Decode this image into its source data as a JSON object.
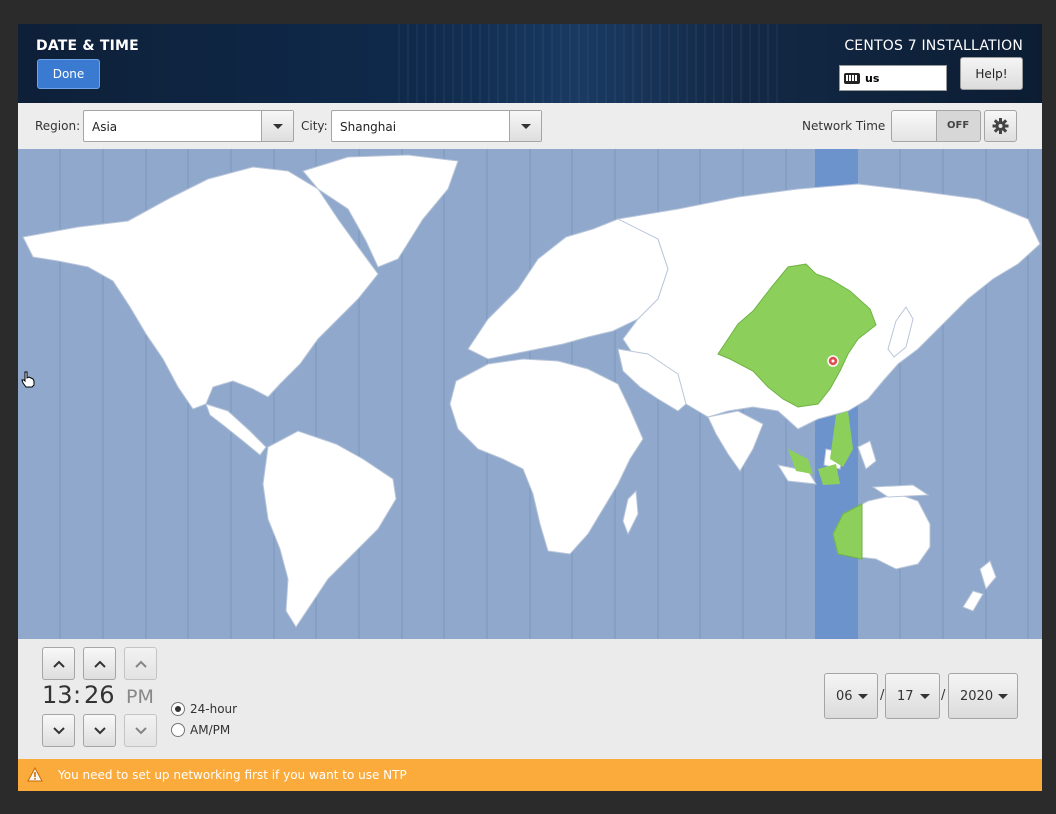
{
  "header": {
    "page_title": "DATE & TIME",
    "done_label": "Done",
    "install_title": "CENTOS 7 INSTALLATION",
    "keyboard_layout": "us",
    "help_label": "Help!"
  },
  "toolbar": {
    "region_label": "Region:",
    "region_value": "Asia",
    "city_label": "City:",
    "city_value": "Shanghai",
    "network_time_label": "Network Time",
    "network_time_state": "OFF"
  },
  "time": {
    "hours": "13",
    "separator": ":",
    "minutes": "26",
    "ampm": "PM",
    "format_24h_label": "24-hour",
    "format_ampm_label": "AM/PM",
    "selected_format": "24-hour"
  },
  "date": {
    "month": "06",
    "day": "17",
    "year": "2020",
    "separator": "/"
  },
  "warning": {
    "text": "You need to set up networking first if you want to use NTP",
    "icon": "warning-icon"
  },
  "colors": {
    "ocean": "#8fa8cb",
    "selected_timezone_band": "#6d93cc",
    "selected_country": "#8cd05b",
    "land": "#ffffff",
    "warning_bar": "#fbab3b",
    "done_button": "#3a7bd1"
  }
}
